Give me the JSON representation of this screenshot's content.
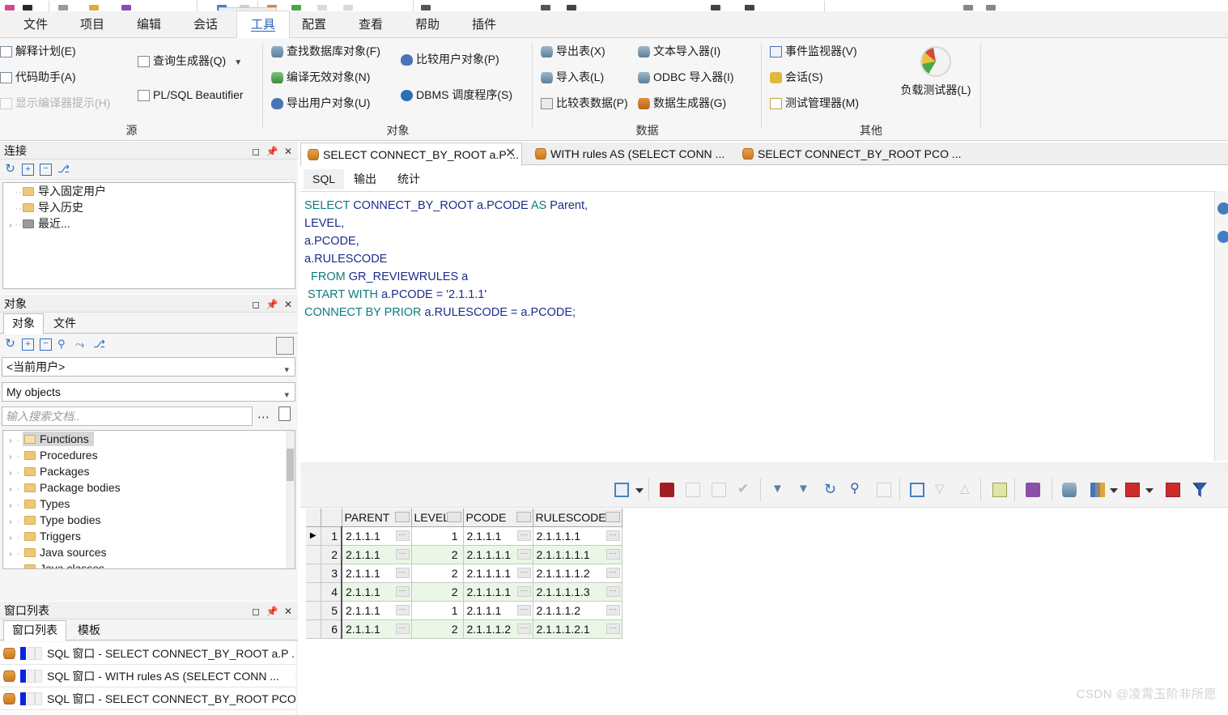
{
  "menubar": {
    "items": [
      {
        "label": "文件",
        "active": false
      },
      {
        "label": "项目",
        "active": false
      },
      {
        "label": "编辑",
        "active": false
      },
      {
        "label": "会话",
        "active": false
      },
      {
        "label": "工具",
        "active": true
      },
      {
        "label": "配置",
        "active": false
      },
      {
        "label": "查看",
        "active": false
      },
      {
        "label": "帮助",
        "active": false
      },
      {
        "label": "插件",
        "active": false
      }
    ]
  },
  "ribbon": {
    "groups": [
      {
        "name": "source",
        "label": "源",
        "items": [
          {
            "label": "解释计划(E)",
            "icon": "explain-plan-icon",
            "disabled": false
          },
          {
            "label": "代码助手(A)",
            "icon": "code-assistant-icon",
            "disabled": false
          },
          {
            "label": "显示编译器提示(H)",
            "icon": "compiler-hints-icon",
            "disabled": true
          },
          {
            "label": "查询生成器(Q)",
            "icon": "query-builder-icon",
            "disabled": false,
            "dropdown": true
          },
          {
            "label": "PL/SQL Beautifier",
            "icon": "beautifier-icon",
            "disabled": false
          }
        ]
      },
      {
        "name": "object",
        "label": "对象",
        "items": [
          {
            "label": "查找数据库对象(F)",
            "icon": "find-db-object-icon",
            "disabled": false
          },
          {
            "label": "编译无效对象(N)",
            "icon": "compile-invalid-icon",
            "disabled": false
          },
          {
            "label": "导出用户对象(U)",
            "icon": "export-user-object-icon",
            "disabled": false
          },
          {
            "label": "比较用户对象(P)",
            "icon": "compare-user-object-icon",
            "disabled": false
          },
          {
            "label": "DBMS 调度程序(S)",
            "icon": "dbms-scheduler-icon",
            "disabled": false
          }
        ]
      },
      {
        "name": "data",
        "label": "数据",
        "items": [
          {
            "label": "导出表(X)",
            "icon": "export-table-icon",
            "disabled": false
          },
          {
            "label": "导入表(L)",
            "icon": "import-table-icon",
            "disabled": false
          },
          {
            "label": "比较表数据(P)",
            "icon": "compare-table-data-icon",
            "disabled": false
          },
          {
            "label": "文本导入器(I)",
            "icon": "text-importer-icon",
            "disabled": false
          },
          {
            "label": "ODBC 导入器(I)",
            "icon": "odbc-importer-icon",
            "disabled": false
          },
          {
            "label": "数据生成器(G)",
            "icon": "data-generator-icon",
            "disabled": false
          }
        ]
      },
      {
        "name": "other",
        "label": "其他",
        "items": [
          {
            "label": "事件监视器(V)",
            "icon": "event-monitor-icon",
            "disabled": false
          },
          {
            "label": "会话(S)",
            "icon": "sessions-icon",
            "disabled": false
          },
          {
            "label": "测试管理器(M)",
            "icon": "test-manager-icon",
            "disabled": false
          }
        ],
        "big_button": {
          "label": "负载测试器(L)",
          "icon": "load-tester-gauge-icon"
        }
      }
    ]
  },
  "connections_panel": {
    "title": "连接",
    "window_buttons": [
      "maximize-icon",
      "pin-icon",
      "close-icon"
    ],
    "toolbar_icons": [
      "refresh-icon",
      "expand-all-icon",
      "collapse-all-icon",
      "new-connection-icon"
    ],
    "tree": [
      {
        "label": "导入固定用户",
        "icon": "folder-icon",
        "expandable": false
      },
      {
        "label": "导入历史",
        "icon": "folder-icon",
        "expandable": false
      },
      {
        "label": "最近...",
        "icon": "folder-grey-icon",
        "expandable": true
      }
    ]
  },
  "objects_panel": {
    "title": "对象",
    "window_buttons": [
      "maximize-icon",
      "pin-icon",
      "close-icon"
    ],
    "tabs": [
      {
        "label": "对象",
        "active": true
      },
      {
        "label": "文件",
        "active": false
      }
    ],
    "toolbar_icons": [
      "refresh-icon",
      "expand-all-icon",
      "collapse-all-icon",
      "find-icon",
      "filter-icon",
      "new-object-icon"
    ],
    "user_select": "<当前用户>",
    "scope_select": "My objects",
    "search_placeholder": "输入搜索文档..",
    "search_value": "",
    "search_buttons": [
      "more-options-icon",
      "new-document-icon"
    ],
    "tree": [
      {
        "label": "Functions",
        "selected": true
      },
      {
        "label": "Procedures",
        "selected": false
      },
      {
        "label": "Packages",
        "selected": false
      },
      {
        "label": "Package bodies",
        "selected": false
      },
      {
        "label": "Types",
        "selected": false
      },
      {
        "label": "Type bodies",
        "selected": false
      },
      {
        "label": "Triggers",
        "selected": false
      },
      {
        "label": "Java sources",
        "selected": false
      },
      {
        "label": "Java classes",
        "selected": false
      }
    ]
  },
  "window_list_panel": {
    "title": "窗口列表",
    "window_buttons": [
      "maximize-icon",
      "pin-icon",
      "close-icon"
    ],
    "tabs": [
      {
        "label": "窗口列表",
        "active": true
      },
      {
        "label": "模板",
        "active": false
      }
    ],
    "items": [
      {
        "label": "SQL 窗口 - SELECT CONNECT_BY_ROOT a.P ..."
      },
      {
        "label": "SQL 窗口 - WITH rules AS (SELECT CONN ..."
      },
      {
        "label": "SQL 窗口 - SELECT CONNECT_BY_ROOT PCO ..."
      }
    ]
  },
  "editor": {
    "doc_tabs": [
      {
        "label": "SELECT CONNECT_BY_ROOT a.P ...",
        "active": true,
        "closable": true
      },
      {
        "label": "WITH rules AS (SELECT CONN ...",
        "active": false,
        "closable": false
      },
      {
        "label": "SELECT CONNECT_BY_ROOT PCO ...",
        "active": false,
        "closable": false
      }
    ],
    "sub_tabs": [
      {
        "label": "SQL",
        "active": true
      },
      {
        "label": "输出",
        "active": false
      },
      {
        "label": "统计",
        "active": false
      }
    ],
    "code_lines": [
      [
        {
          "t": "SELECT ",
          "c": "kw"
        },
        {
          "t": "CONNECT_BY_ROOT a.PCODE ",
          "c": "id"
        },
        {
          "t": "AS ",
          "c": "kw"
        },
        {
          "t": "Parent,",
          "c": "id"
        }
      ],
      [
        {
          "t": "LEVEL,",
          "c": "id"
        }
      ],
      [
        {
          "t": "a.PCODE,",
          "c": "id"
        }
      ],
      [
        {
          "t": "a.RULESCODE",
          "c": "id"
        }
      ],
      [
        {
          "t": "  FROM ",
          "c": "kw"
        },
        {
          "t": "GR_REVIEWRULES a",
          "c": "id"
        }
      ],
      [
        {
          "t": " START WITH ",
          "c": "kw"
        },
        {
          "t": "a.PCODE = ",
          "c": "id"
        },
        {
          "t": "'2.1.1.1'",
          "c": "str"
        }
      ],
      [
        {
          "t": "CONNECT BY PRIOR ",
          "c": "kw"
        },
        {
          "t": "a.RULESCODE = a.PCODE;",
          "c": "id"
        }
      ]
    ]
  },
  "results_toolbar": {
    "icons": [
      "grid-mode-icon",
      "grid-mode-caret",
      "sep1",
      "lock-icon",
      "insert-row-icon",
      "delete-row-icon",
      "post-changes-icon",
      "sep2",
      "next-page-icon",
      "last-page-icon",
      "refresh-icon",
      "find-icon",
      "clear-filter-icon",
      "sep3",
      "single-record-view-icon",
      "move-down-icon",
      "move-up-icon",
      "sep4",
      "split-icon",
      "sep5",
      "save-icon",
      "sep6",
      "export-db-icon",
      "chart-icon",
      "chart-caret",
      "table-view-icon",
      "table-caret",
      "duplicate-icon",
      "filter-icon"
    ]
  },
  "results_grid": {
    "columns": [
      "PARENT",
      "LEVEL",
      "PCODE",
      "RULESCODE"
    ],
    "rows": [
      {
        "n": "1",
        "current": true,
        "cells": [
          "2.1.1.1",
          "1",
          "2.1.1.1",
          "2.1.1.1.1"
        ]
      },
      {
        "n": "2",
        "current": false,
        "cells": [
          "2.1.1.1",
          "2",
          "2.1.1.1.1",
          "2.1.1.1.1.1"
        ]
      },
      {
        "n": "3",
        "current": false,
        "cells": [
          "2.1.1.1",
          "2",
          "2.1.1.1.1",
          "2.1.1.1.1.2"
        ]
      },
      {
        "n": "4",
        "current": false,
        "cells": [
          "2.1.1.1",
          "2",
          "2.1.1.1.1",
          "2.1.1.1.1.3"
        ]
      },
      {
        "n": "5",
        "current": false,
        "cells": [
          "2.1.1.1",
          "1",
          "2.1.1.1",
          "2.1.1.1.2"
        ]
      },
      {
        "n": "6",
        "current": false,
        "cells": [
          "2.1.1.1",
          "2",
          "2.1.1.1.2",
          "2.1.1.1.2.1"
        ]
      }
    ]
  },
  "watermark": "CSDN @凌霄玉阶非所愿",
  "colors": {
    "accent": "#2a62b6",
    "keyword": "#0f7b7b",
    "identifier": "#1c2c8c",
    "alt_row": "#eaf7e6",
    "folder": "#eec87a",
    "ribbon_bg": "#f6f6f6"
  }
}
